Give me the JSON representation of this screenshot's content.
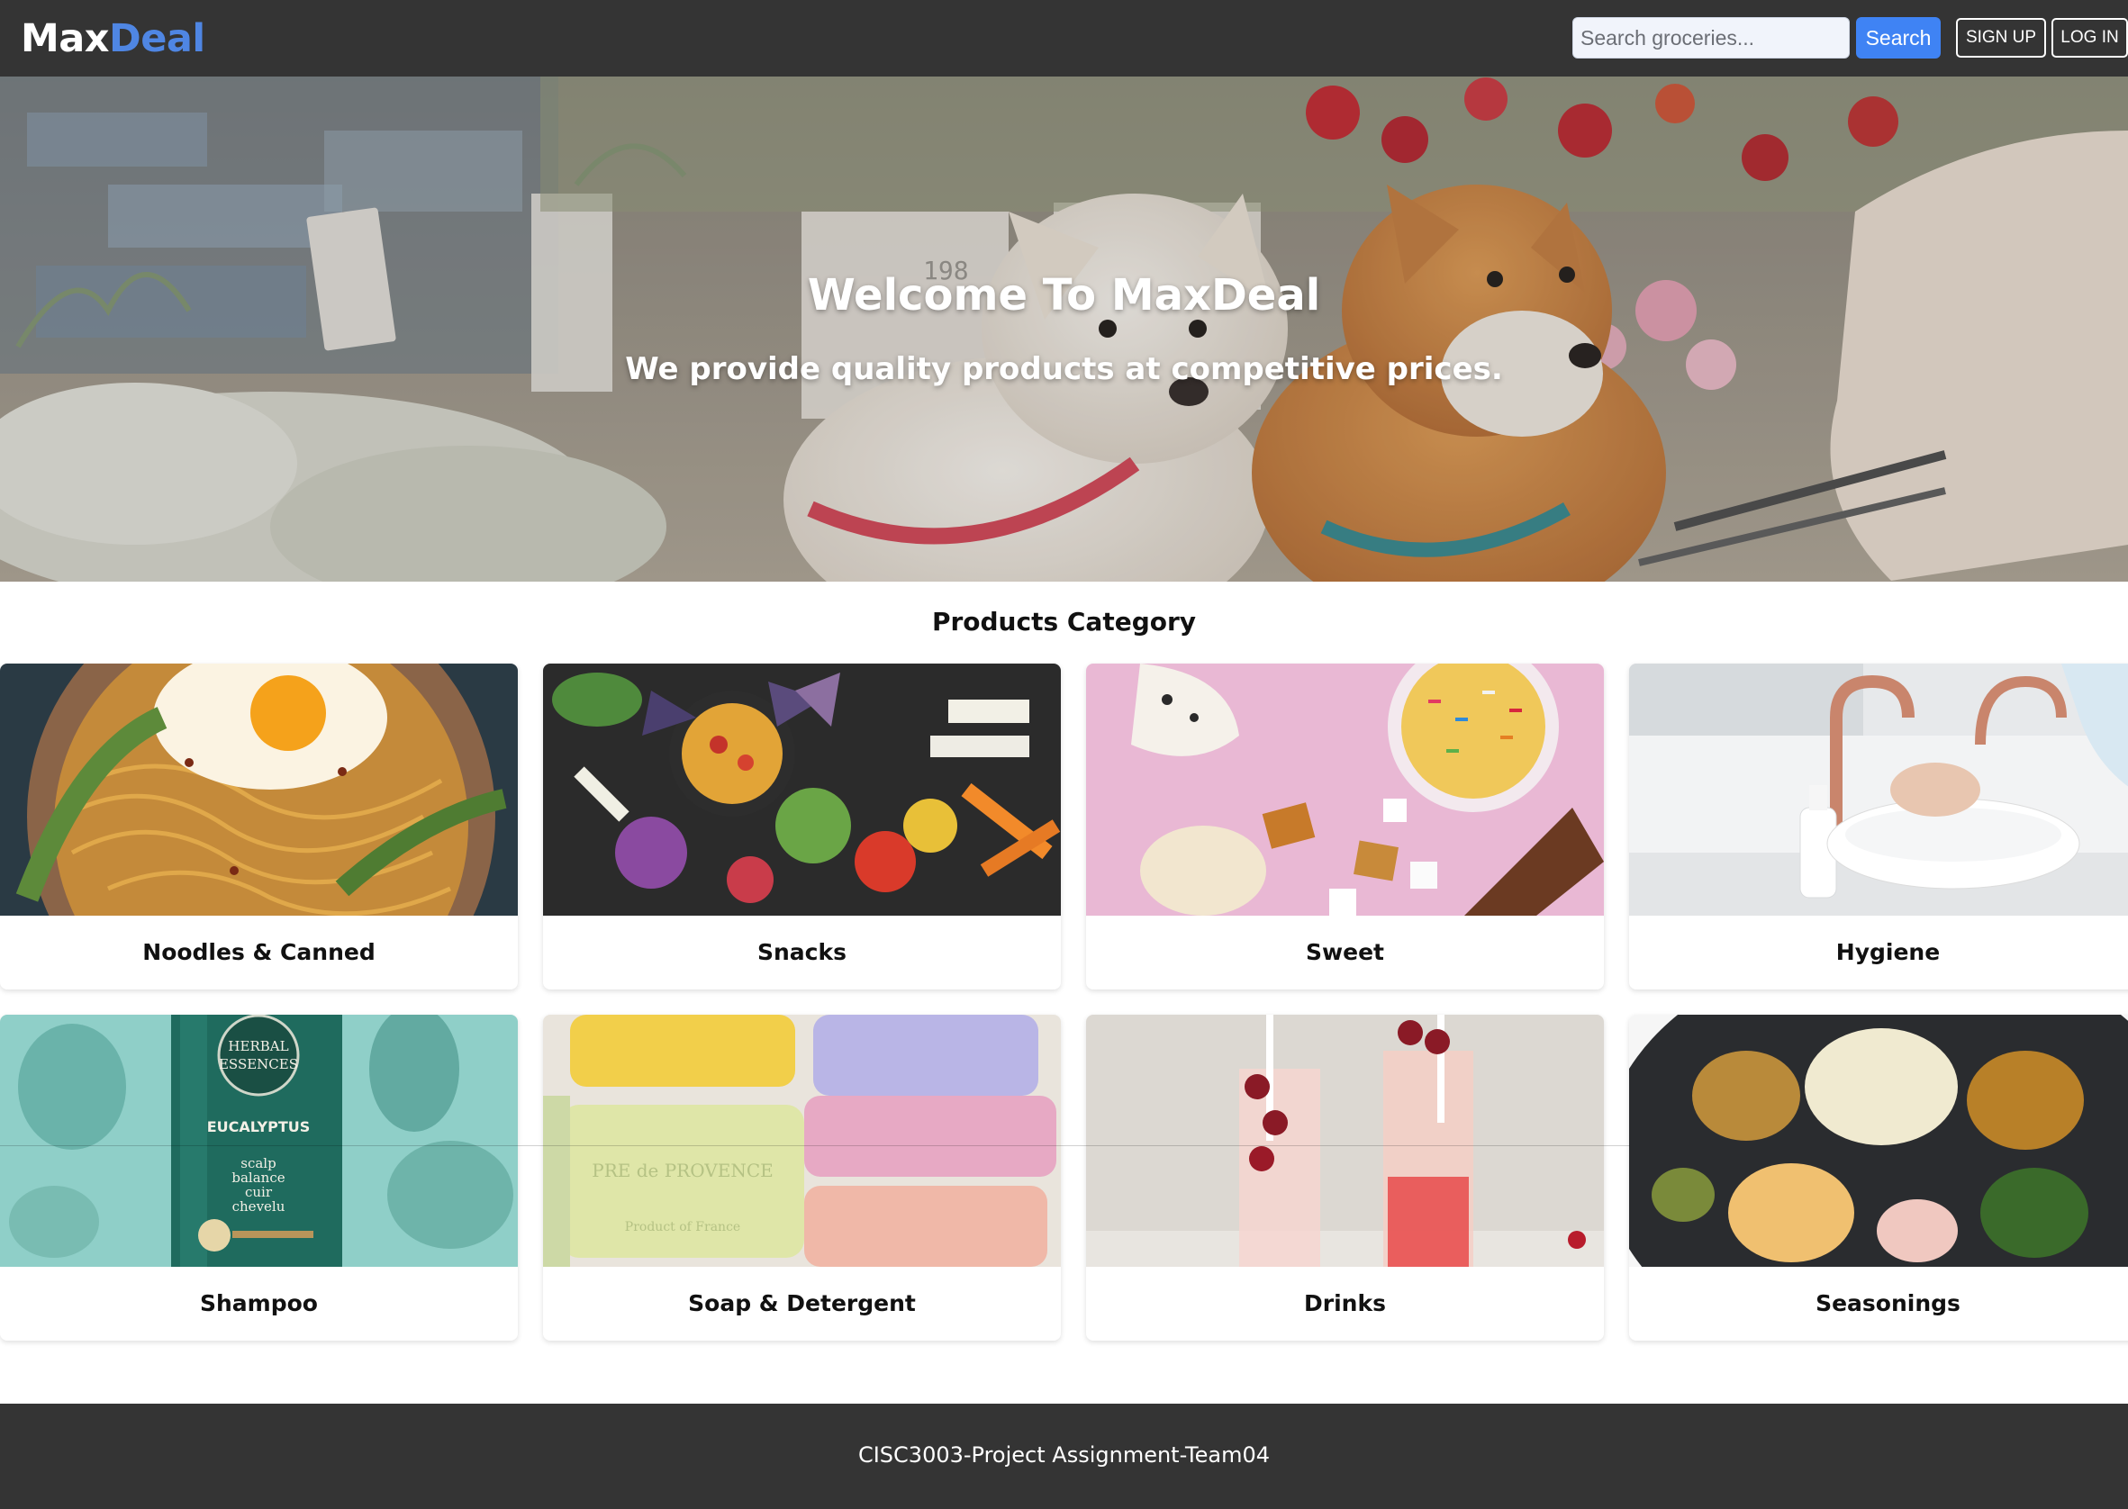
{
  "brand": {
    "part1": "Max",
    "part2": "Deal",
    "accent": "#4f86e3"
  },
  "header": {
    "search_placeholder": "Search groceries...",
    "search_button": "Search",
    "signup": "SIGN UP",
    "login": "LOG IN"
  },
  "hero": {
    "title": "Welcome To MaxDeal",
    "subtitle": "We provide quality products at competitive prices.",
    "sign_price": "198"
  },
  "categories": {
    "title": "Products Category",
    "items": [
      {
        "label": "Noodles & Canned"
      },
      {
        "label": "Snacks"
      },
      {
        "label": "Sweet"
      },
      {
        "label": "Hygiene"
      },
      {
        "label": "Shampoo"
      },
      {
        "label": "Soap & Detergent"
      },
      {
        "label": "Drinks"
      },
      {
        "label": "Seasonings"
      }
    ]
  },
  "product_text": {
    "shampoo_brand_1": "HERBAL",
    "shampoo_brand_2": "ESSENCES",
    "shampoo_name": "EUCALYPTUS",
    "shampoo_line1": "scalp",
    "shampoo_line2": "balance",
    "shampoo_line3": "cuir",
    "shampoo_line4": "chevelu",
    "soap_brand": "PRE de PROVENCE",
    "soap_origin": "Product of France"
  },
  "footer": {
    "text": "CISC3003-Project Assignment-Team04"
  }
}
